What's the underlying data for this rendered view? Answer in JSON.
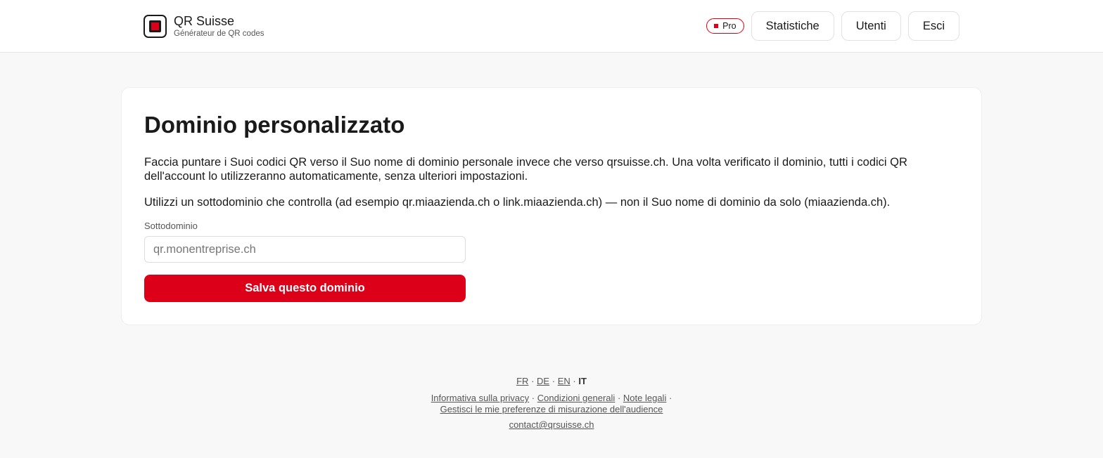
{
  "header": {
    "brand_name": "QR Suisse",
    "brand_sub": "Générateur de QR codes",
    "pro_badge": "Pro",
    "nav": [
      "Statistiche",
      "Utenti",
      "Esci"
    ]
  },
  "main": {
    "title": "Dominio personalizzato",
    "description": "Faccia puntare i Suoi codici QR verso il Suo nome di dominio personale invece che verso qrsuisse.ch. Una volta verificato il dominio, tutti i codici QR dell'account lo utilizzeranno automaticamente, senza ulteriori impostazioni.",
    "hint": "Utilizzi un sottodominio che controlla (ad esempio qr.miaazienda.ch o link.miaazienda.ch) — non il Suo nome di dominio da solo (miaazienda.ch).",
    "field_label": "Sottodominio",
    "field_placeholder": "qr.monentreprise.ch",
    "field_value": "",
    "save_label": "Salva questo dominio"
  },
  "footer": {
    "languages": [
      "FR",
      "DE",
      "EN",
      "IT"
    ],
    "current_language": "IT",
    "separator": "·",
    "links": [
      "Informativa sulla privacy",
      "Condizioni generali",
      "Note legali",
      "Gestisci le mie preferenze di misurazione dell'audience"
    ],
    "contact": "contact@qrsuisse.ch"
  },
  "colors": {
    "accent": "#dc0018",
    "background": "#f8f8f8",
    "card": "#ffffff",
    "text": "#1a1a1a"
  }
}
